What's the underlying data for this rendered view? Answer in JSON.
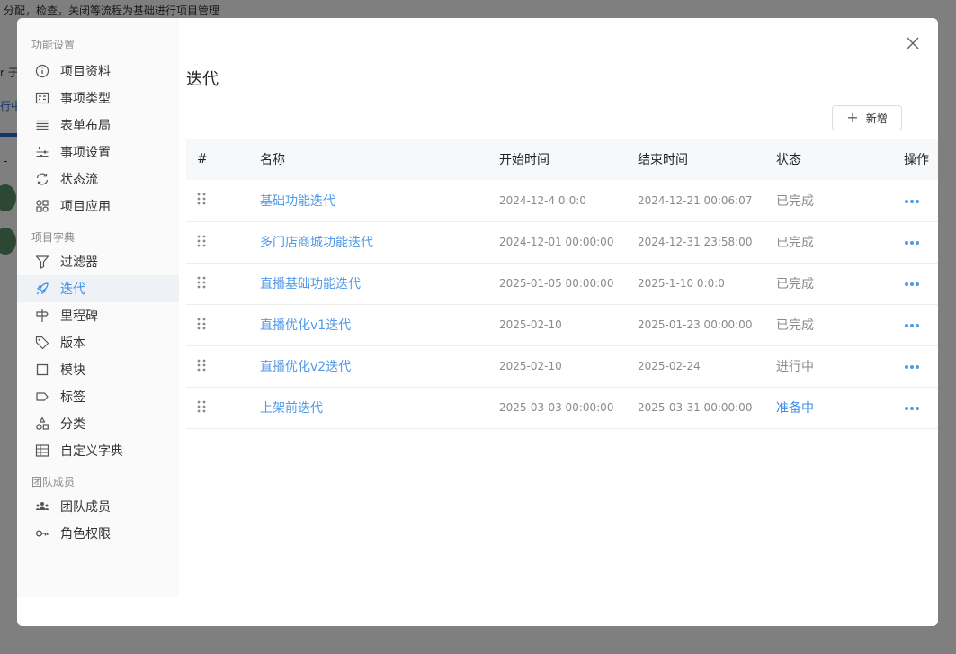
{
  "background": {
    "header_text": "分配，检查，关闭等流程为基础进行项目管理",
    "fragment_1": "r 于",
    "fragment_2": "行中",
    "fragment_3": "-"
  },
  "sidebar": {
    "groups": [
      {
        "title": "功能设置",
        "items": [
          {
            "label": "项目资料",
            "icon": "info-circle-icon"
          },
          {
            "label": "事项类型",
            "icon": "task-type-icon"
          },
          {
            "label": "表单布局",
            "icon": "form-layout-icon"
          },
          {
            "label": "事项设置",
            "icon": "sliders-icon"
          },
          {
            "label": "状态流",
            "icon": "refresh-arrows-icon"
          },
          {
            "label": "项目应用",
            "icon": "apps-icon"
          }
        ]
      },
      {
        "title": "项目字典",
        "items": [
          {
            "label": "过滤器",
            "icon": "filter-icon"
          },
          {
            "label": "迭代",
            "icon": "rocket-icon",
            "active": true
          },
          {
            "label": "里程碑",
            "icon": "signpost-icon"
          },
          {
            "label": "版本",
            "icon": "tag-icon"
          },
          {
            "label": "模块",
            "icon": "square-icon"
          },
          {
            "label": "标签",
            "icon": "label-icon"
          },
          {
            "label": "分类",
            "icon": "shapes-icon"
          },
          {
            "label": "自定义字典",
            "icon": "table-icon"
          }
        ]
      },
      {
        "title": "团队成员",
        "items": [
          {
            "label": "团队成员",
            "icon": "team-icon"
          },
          {
            "label": "角色权限",
            "icon": "key-icon"
          }
        ]
      }
    ]
  },
  "main": {
    "title": "迭代",
    "add_label": "新增",
    "columns": {
      "hash": "#",
      "name": "名称",
      "start": "开始时间",
      "end": "结束时间",
      "status": "状态",
      "op": "操作"
    },
    "rows": [
      {
        "name": "基础功能迭代",
        "start": "2024-12-4 0:0:0",
        "end": "2024-12-21 00:06:07",
        "status": "已完成"
      },
      {
        "name": "多门店商城功能迭代",
        "start": "2024-12-01 00:00:00",
        "end": "2024-12-31 23:58:00",
        "status": "已完成"
      },
      {
        "name": "直播基础功能迭代",
        "start": "2025-01-05 00:00:00",
        "end": "2025-1-10 0:0:0",
        "status": "已完成"
      },
      {
        "name": "直播优化v1迭代",
        "start": "2025-02-10",
        "end": "2025-01-23 00:00:00",
        "status": "已完成"
      },
      {
        "name": "直播优化v2迭代",
        "start": "2025-02-10",
        "end": "2025-02-24",
        "status": "进行中"
      },
      {
        "name": "上架前迭代",
        "start": "2025-03-03 00:00:00",
        "end": "2025-03-31 00:00:00",
        "status": "准备中"
      }
    ]
  },
  "colors": {
    "accent": "#3d8fe6",
    "link": "#4f9ae8",
    "sidebar_bg": "#fafafa",
    "active_bg": "#eef1f5",
    "overlay": "#7f7f7f"
  }
}
